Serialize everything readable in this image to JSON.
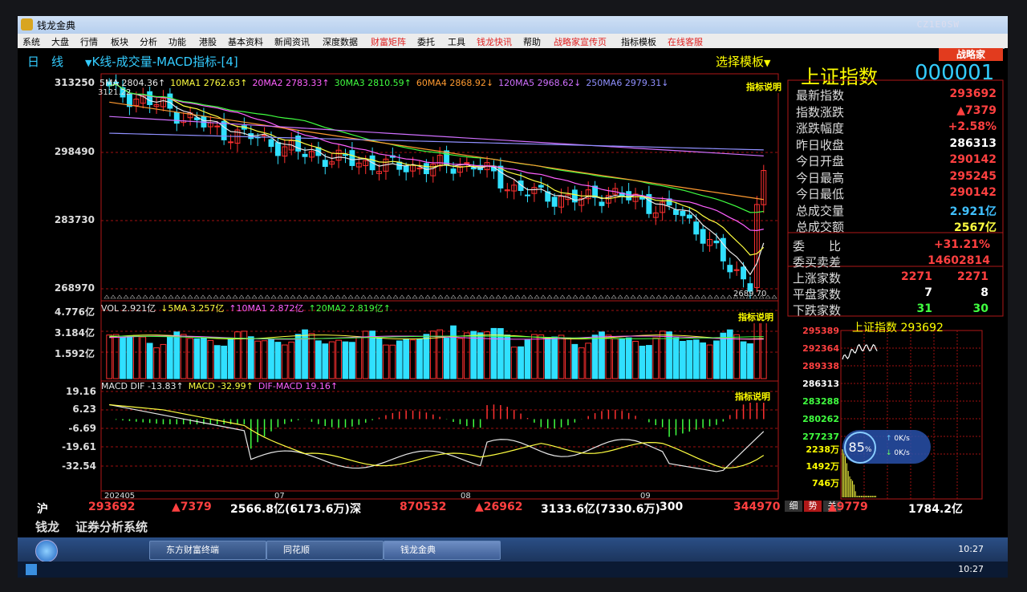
{
  "window": {
    "title": "钱龙金典",
    "watermark": "CZ1E0SW"
  },
  "menu": [
    "系统",
    "大盘",
    "行情",
    "板块",
    "分析",
    "功能",
    "港股",
    "基本资料",
    "新闻资讯",
    "深度数据",
    "财富矩阵",
    "委托",
    "工具",
    "钱龙快讯",
    "帮助",
    "战略家宣传页",
    "指标模板",
    "在线客服"
  ],
  "menu_colors": {
    "财富矩阵": "#e02020",
    "钱龙快讯": "#e02020",
    "战略家宣传页": "#e02020",
    "在线客服": "#e02020"
  },
  "brand_button": "战略家",
  "header": {
    "period": "日　线",
    "title": "K线-成交量-MACD指标-[4]",
    "select_template": "选择模板",
    "index_name": "上证指数",
    "index_code": "000001"
  },
  "price_axis": [
    "313250",
    "298490",
    "283730",
    "268970"
  ],
  "price_extremes": {
    "high_label": "3121.22",
    "low_label": "2689.70"
  },
  "ma_legend": [
    {
      "text": "5MA 2804.36↑",
      "color": "#e8e8e8"
    },
    {
      "text": "10MA1 2762.63↑",
      "color": "#ffff40"
    },
    {
      "text": "20MA2 2783.33↑",
      "color": "#ff60ff"
    },
    {
      "text": "30MA3 2810.59↑",
      "color": "#40ff40"
    },
    {
      "text": "60MA4 2868.92↓",
      "color": "#ff9a30"
    },
    {
      "text": "120MA5 2968.62↓",
      "color": "#d070ff"
    },
    {
      "text": "250MA6 2979.31↓",
      "color": "#9090ff"
    }
  ],
  "vol_axis": [
    "4.776亿",
    "3.184亿",
    "1.592亿"
  ],
  "vol_legend": [
    {
      "text": "VOL 2.921亿",
      "color": "#e8e8e8"
    },
    {
      "text": "↓5MA 3.257亿",
      "color": "#ffff40"
    },
    {
      "text": "↑10MA1 2.872亿",
      "color": "#ff60ff"
    },
    {
      "text": "↑20MA2 2.819亿↑",
      "color": "#40ff40"
    }
  ],
  "macd_axis": [
    "19.16",
    "6.23",
    "-6.69",
    "-19.61",
    "-32.54"
  ],
  "macd_legend": [
    {
      "text": "MACD DIF -13.83↑",
      "color": "#e8e8e8"
    },
    {
      "text": "MACD -32.99↑",
      "color": "#ffff40"
    },
    {
      "text": "DIF-MACD 19.16↑",
      "color": "#ff60ff"
    }
  ],
  "indicator_note": "指标说明",
  "date_axis": [
    "202405",
    "07",
    "08",
    "09"
  ],
  "quote": {
    "rows": [
      {
        "label": "最新指数",
        "value": "293692",
        "color": "#ff4040"
      },
      {
        "label": "指数涨跌",
        "value": "▲7379",
        "color": "#ff4040"
      },
      {
        "label": "涨跌幅度",
        "value": "+2.58%",
        "color": "#ff4040"
      },
      {
        "label": "昨日收盘",
        "value": "286313",
        "color": "#ffffff"
      },
      {
        "label": "今日开盘",
        "value": "290142",
        "color": "#ff4040"
      },
      {
        "label": "今日最高",
        "value": "295245",
        "color": "#ff4040"
      },
      {
        "label": "今日最低",
        "value": "290142",
        "color": "#ff4040"
      },
      {
        "label": "总成交量",
        "value": "2.921亿",
        "color": "#40c0ff"
      },
      {
        "label": "总成交额",
        "value": "2567亿",
        "color": "#ffff40"
      }
    ],
    "ratio_label": "委　　比",
    "ratio_value": "+31.21%",
    "diff_label": "委买卖差",
    "diff_value": "14602814",
    "breadth": [
      {
        "label": "上涨家数",
        "v1": "2271",
        "v2": "2271",
        "color": "#ff4040"
      },
      {
        "label": "平盘家数",
        "v1": "7",
        "v2": "8",
        "color": "#ffffff"
      },
      {
        "label": "下跌家数",
        "v1": "31",
        "v2": "30",
        "color": "#40ff40"
      }
    ]
  },
  "mini_chart": {
    "title": "上证指数 293692",
    "price_axis": [
      {
        "v": "295389",
        "c": "#ff4040"
      },
      {
        "v": "292364",
        "c": "#ff4040"
      },
      {
        "v": "289338",
        "c": "#ff4040"
      },
      {
        "v": "286313",
        "c": "#ffffff"
      },
      {
        "v": "283288",
        "c": "#40ff40"
      },
      {
        "v": "280262",
        "c": "#40ff40"
      },
      {
        "v": "277237",
        "c": "#40ff40"
      }
    ],
    "vol_axis": [
      "2238万",
      "1492万",
      "746万"
    ],
    "tabs": [
      "细",
      "势",
      "关"
    ],
    "widget": {
      "percent": "85",
      "percent_unit": "%",
      "up": "0K/s",
      "down": "0K/s"
    }
  },
  "bottom": {
    "sh_label": "沪",
    "sh_index": "293692",
    "sh_change": "▲7379",
    "sh_amount": "2566.8亿(6173.6万)",
    "sz_label": "深",
    "sz_index": "870532",
    "sz_change": "▲26962",
    "sz_amount": "3133.6亿(7330.6万)",
    "c300_label": "300",
    "c300_index": "344970",
    "c300_change": "▲9779",
    "c300_amount": "1784.2亿",
    "brand": "钱龙",
    "system": "证券分析系统"
  },
  "taskbar": {
    "apps": [
      "东方财富终端",
      "同花顺",
      "钱龙金典"
    ],
    "time": "10:27"
  },
  "colors": {
    "up": "#ff3030",
    "down": "#30e0ff",
    "grid": "#a01010",
    "bg": "#000000"
  }
}
